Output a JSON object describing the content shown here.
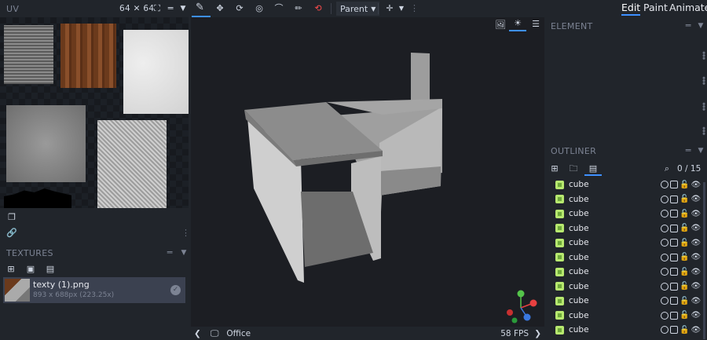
{
  "uv": {
    "title": "UV",
    "size": "64 ✕ 64"
  },
  "toolbar": {
    "parent_label": "Parent"
  },
  "modes": {
    "edit": "Edit",
    "paint": "Paint",
    "animate": "Animate"
  },
  "textures": {
    "title": "TEXTURES",
    "item": {
      "name": "texty (1).png",
      "meta": "893 x 688px (223.25x)"
    }
  },
  "element": {
    "title": "ELEMENT"
  },
  "outliner": {
    "title": "OUTLINER",
    "count": "0 / 15",
    "items": [
      "cube",
      "cube",
      "cube",
      "cube",
      "cube",
      "cube",
      "cube",
      "cube",
      "cube",
      "cube",
      "cube"
    ]
  },
  "viewport": {
    "scene_name": "Office",
    "fps": "58 FPS"
  },
  "colors": {
    "accent": "#3e90ff",
    "cube_icon": "#b7e86f",
    "panel": "#21252b",
    "viewport_bg": "#1c1e23"
  }
}
